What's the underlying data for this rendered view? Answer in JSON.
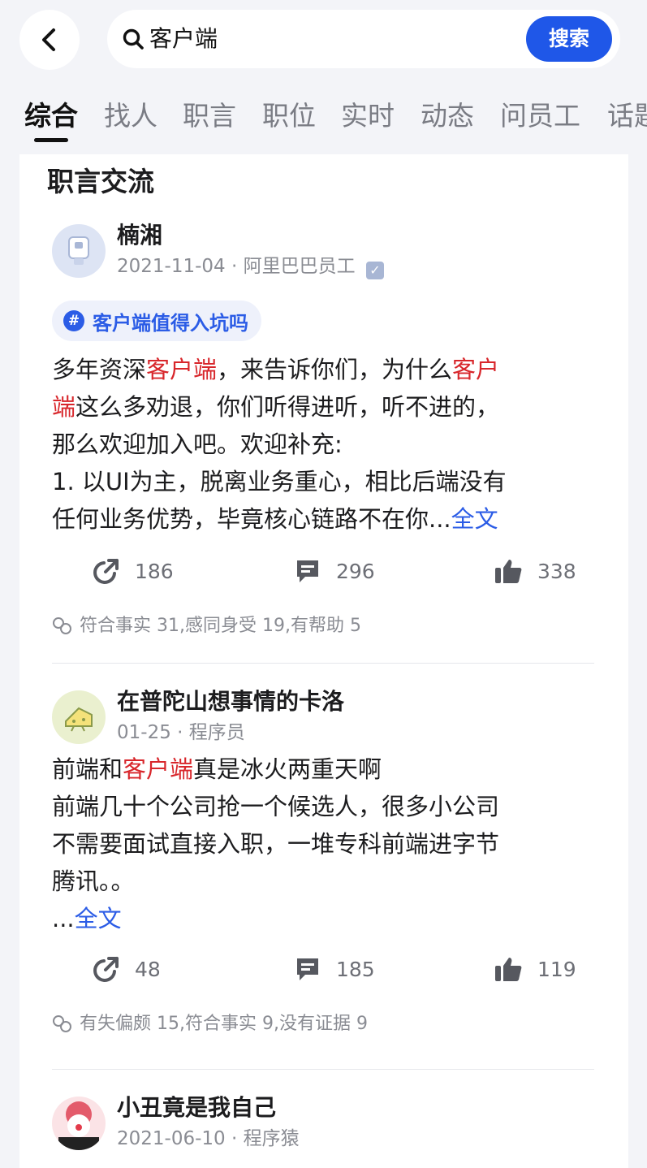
{
  "search": {
    "query": "客户端",
    "button_label": "搜索"
  },
  "tabs": [
    {
      "label": "综合",
      "active": true
    },
    {
      "label": "找人",
      "active": false
    },
    {
      "label": "职言",
      "active": false
    },
    {
      "label": "职位",
      "active": false
    },
    {
      "label": "实时",
      "active": false
    },
    {
      "label": "动态",
      "active": false
    },
    {
      "label": "问员工",
      "active": false
    },
    {
      "label": "话题",
      "active": false
    }
  ],
  "section": {
    "title": "职言交流"
  },
  "posts": [
    {
      "author": "楠湘",
      "date": "2021-11-04",
      "role": "阿里巴巴员工",
      "verified": true,
      "topic": "客户端值得入坑吗",
      "lines": [
        [
          "多年资深",
          "客户端",
          "，来告诉你们，为什么",
          "客户"
        ],
        [
          "端",
          "这么多劝退，你们听得进听，听不进的，"
        ],
        [
          "那么欢迎加入吧。欢迎补充:"
        ],
        [
          "1. 以UI为主，脱离业务重心，相比后端没有"
        ],
        [
          "任何业务优势，毕竟核心链路不在你...",
          "全文"
        ]
      ],
      "shares": "186",
      "comments": "296",
      "likes": "338",
      "reactions": "符合事实 31,感同身受 19,有帮助 5"
    },
    {
      "author": "在普陀山想事情的卡洛",
      "date": "01-25",
      "role": "程序员",
      "lines": [
        [
          "前端和",
          "客户端",
          "真是冰火两重天啊"
        ],
        [
          "前端几十个公司抢一个候选人，很多小公司"
        ],
        [
          "不需要面试直接入职，一堆专科前端进字节"
        ],
        [
          "腾讯。。"
        ],
        [
          "...",
          "全文"
        ]
      ],
      "shares": "48",
      "comments": "185",
      "likes": "119",
      "reactions": "有失偏颇 15,符合事实 9,没有证据 9"
    },
    {
      "author": "小丑竟是我自己",
      "date": "2021-06-10",
      "role": "程序猿"
    }
  ],
  "colors": {
    "accent": "#1f57e8",
    "highlight": "#d8262b",
    "link": "#2b5ce6"
  },
  "icons": [
    "back-arrow-icon",
    "search-icon",
    "share-icon",
    "comment-icon",
    "thumbs-up-icon",
    "reaction-icon",
    "hashtag-icon"
  ]
}
